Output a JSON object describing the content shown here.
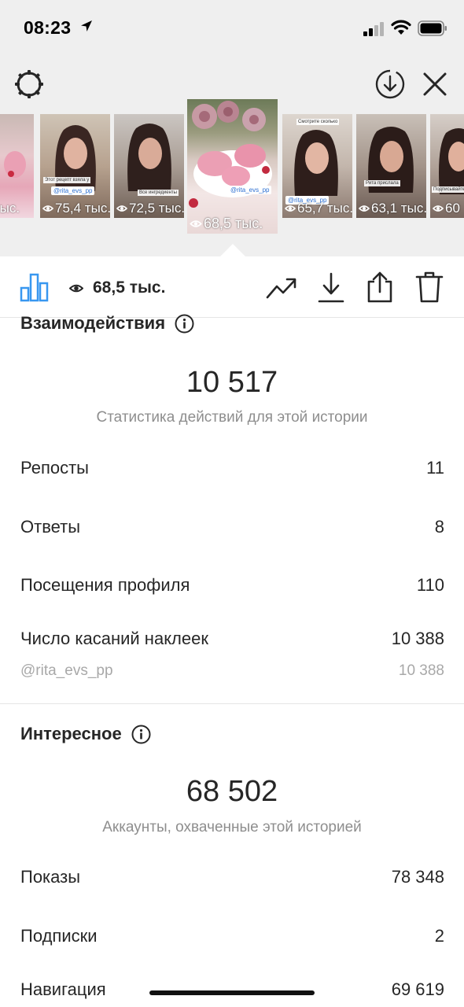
{
  "status_bar": {
    "time": "08:23"
  },
  "stories": [
    {
      "views": ",1 тыс."
    },
    {
      "views": "75,4 тыс.",
      "tag": "@rita_evs_pp"
    },
    {
      "views": "72,5 тыс."
    },
    {
      "views": "68,5 тыс.",
      "tag": "@rita_evs_pp",
      "selected": true
    },
    {
      "views": "65,7 тыс.",
      "tag": "@rita_evs_pp"
    },
    {
      "views": "63,1 тыс."
    },
    {
      "views": "60"
    }
  ],
  "toolbar": {
    "reach_value": "68,5 тыс."
  },
  "interactions": {
    "title": "Взаимодействия",
    "total": "10 517",
    "subtitle": "Статистика действий для этой истории",
    "rows": [
      {
        "label": "Репосты",
        "value": "11"
      },
      {
        "label": "Ответы",
        "value": "8"
      },
      {
        "label": "Посещения профиля",
        "value": "110"
      },
      {
        "label": "Число касаний наклеек",
        "value": "10 388"
      }
    ],
    "sticker_row": {
      "label": "@rita_evs_pp",
      "value": "10 388"
    }
  },
  "discovery": {
    "title": "Интересное",
    "total": "68 502",
    "subtitle": "Аккаунты, охваченные этой историей",
    "rows": [
      {
        "label": "Показы",
        "value": "78 348"
      },
      {
        "label": "Подписки",
        "value": "2"
      },
      {
        "label": "Навигация",
        "value": "69 619"
      }
    ]
  },
  "colors": {
    "accent_blue": "#3897f0",
    "text": "#262626",
    "muted": "#8e8e8e",
    "top_bg": "#efefef"
  },
  "icons": [
    "location-arrow-icon",
    "signal-icon",
    "wifi-icon",
    "battery-icon",
    "settings-gear-icon",
    "download-circle-icon",
    "close-icon",
    "bar-chart-icon",
    "eye-icon",
    "trend-icon",
    "download-icon",
    "share-icon",
    "trash-icon",
    "info-icon"
  ]
}
